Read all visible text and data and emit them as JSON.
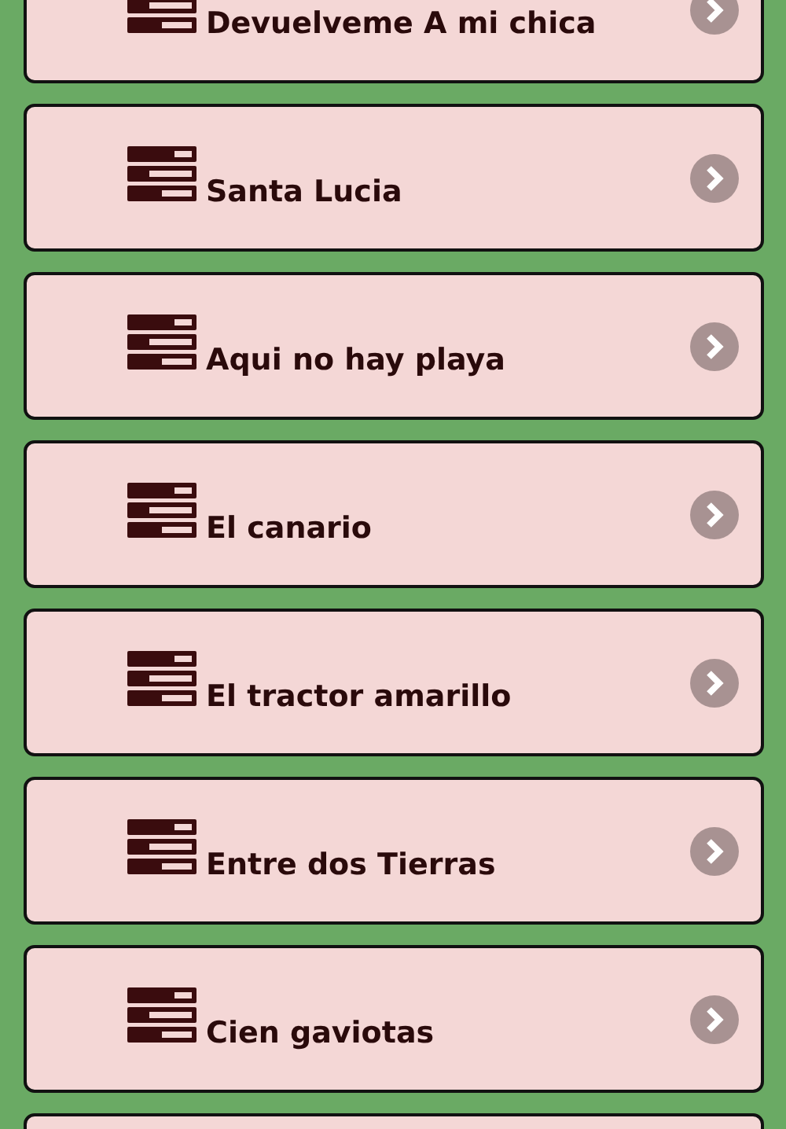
{
  "songs": [
    {
      "title": "Devuelveme A mi chica"
    },
    {
      "title": "Santa Lucia"
    },
    {
      "title": "Aqui no hay playa"
    },
    {
      "title": "El canario"
    },
    {
      "title": "El tractor amarillo"
    },
    {
      "title": "Entre dos Tierras"
    },
    {
      "title": "Cien gaviotas"
    }
  ],
  "list_continues": true
}
